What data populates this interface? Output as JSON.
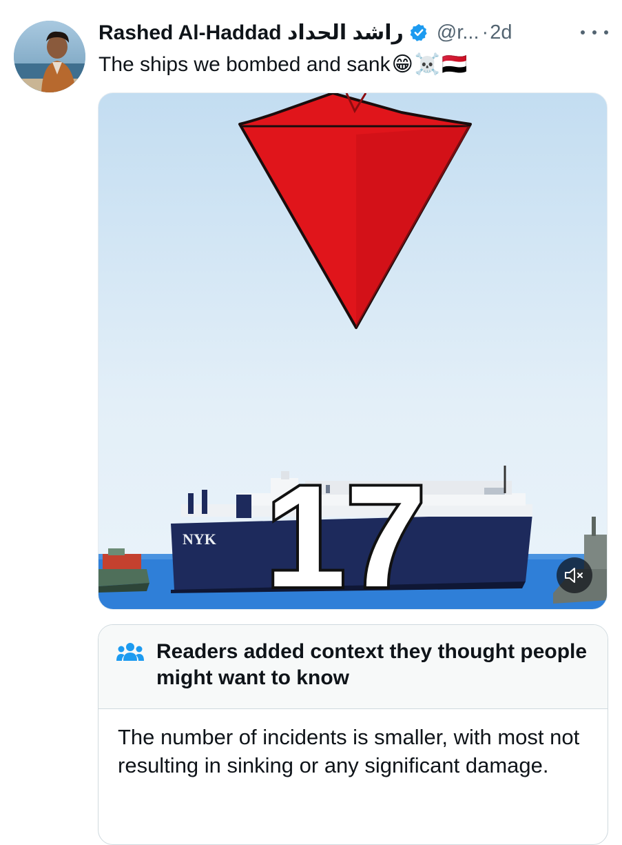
{
  "tweet": {
    "display_name": "Rashed Al-Haddad راشد الحداد",
    "handle": "@r...",
    "separator": "·",
    "time": "2d",
    "text": "The ships we bombed and sank",
    "emojis": [
      "😁",
      "☠️",
      "🇾🇪"
    ],
    "verified_icon": "verified-badge-icon",
    "more_icon": "more-options-icon",
    "avatar_icon": "user-avatar"
  },
  "media": {
    "overlay_number": "17",
    "ship_hull_text": "NYK",
    "mute_icon": "volume-muted-icon"
  },
  "community_note": {
    "icon": "people-icon",
    "title": "Readers added context they thought people might want to know",
    "body": "The number of incidents is smaller, with most not resulting in sinking or any significant damage."
  },
  "colors": {
    "text": "#0f1419",
    "secondary_text": "#536471",
    "verified_blue": "#1d9bf0",
    "note_header_bg": "#f7f9f9",
    "triangle_red": "#e0151b"
  }
}
